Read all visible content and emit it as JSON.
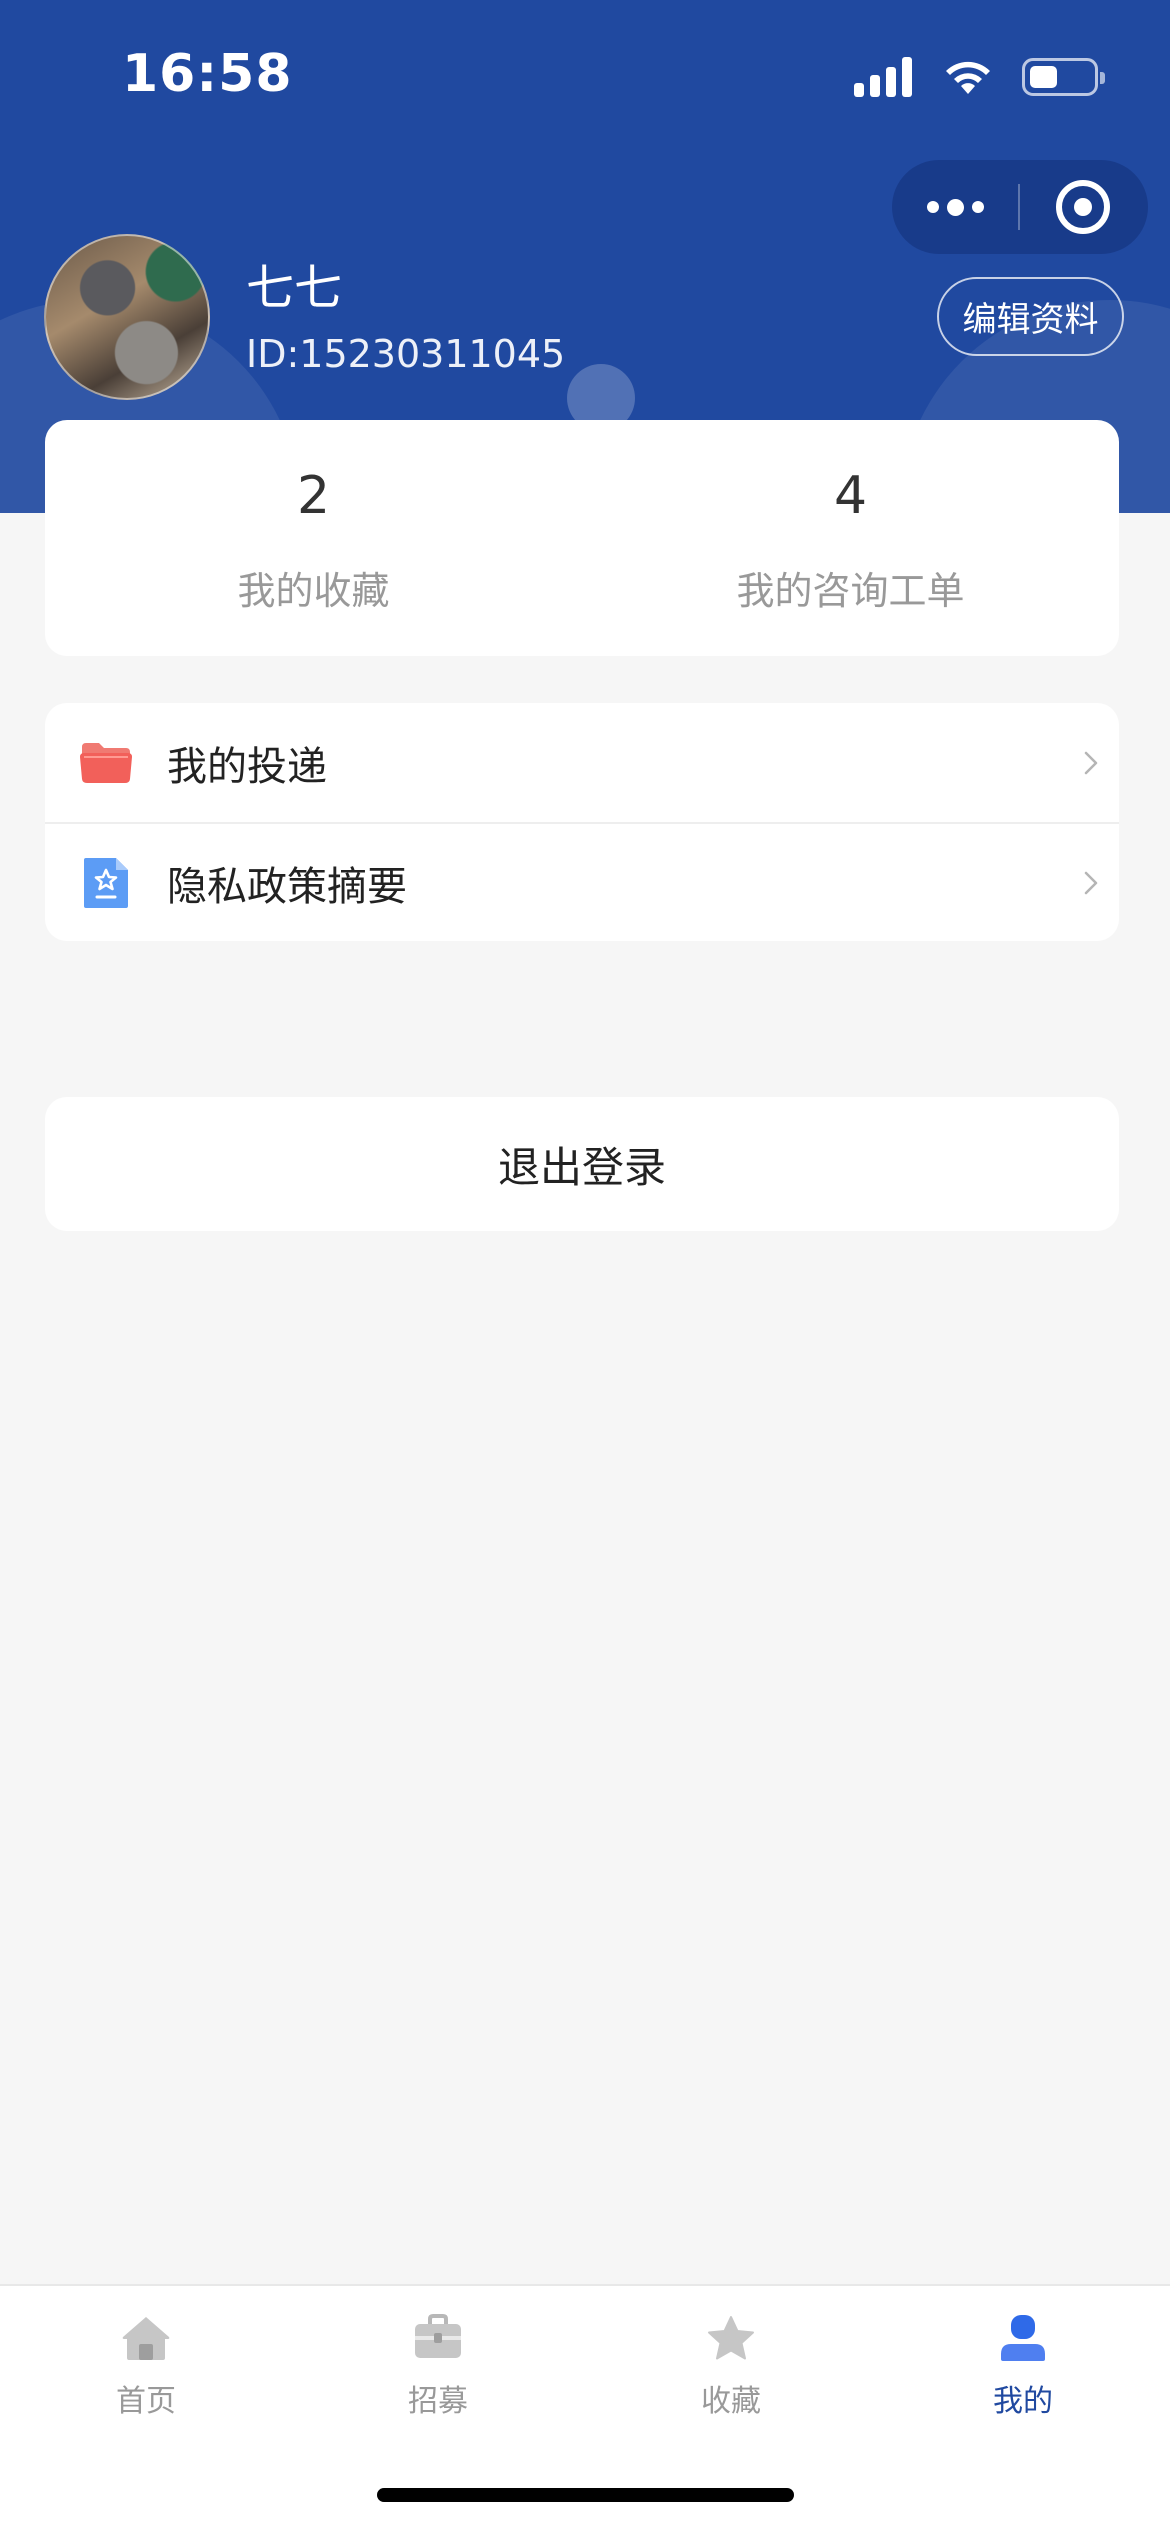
{
  "status_bar": {
    "time": "16:58",
    "battery_level": 0.45
  },
  "profile": {
    "name": "七七",
    "id": "ID:15230311045",
    "edit_label": "编辑资料"
  },
  "stats": [
    {
      "value": "2",
      "label": "我的收藏"
    },
    {
      "value": "4",
      "label": "我的咨询工单"
    }
  ],
  "menu": [
    {
      "label": "我的投递",
      "icon": "folder-icon"
    },
    {
      "label": "隐私政策摘要",
      "icon": "document-star-icon"
    }
  ],
  "logout_label": "退出登录",
  "tabs": [
    {
      "label": "首页",
      "icon": "home-icon",
      "active": false
    },
    {
      "label": "招募",
      "icon": "briefcase-icon",
      "active": false
    },
    {
      "label": "收藏",
      "icon": "star-icon",
      "active": false
    },
    {
      "label": "我的",
      "icon": "user-icon",
      "active": true
    }
  ],
  "colors": {
    "header_bg": "#2049a0",
    "active_tab": "#2049a0",
    "inactive_tab": "#999999",
    "page_bg": "#f6f6f6"
  }
}
